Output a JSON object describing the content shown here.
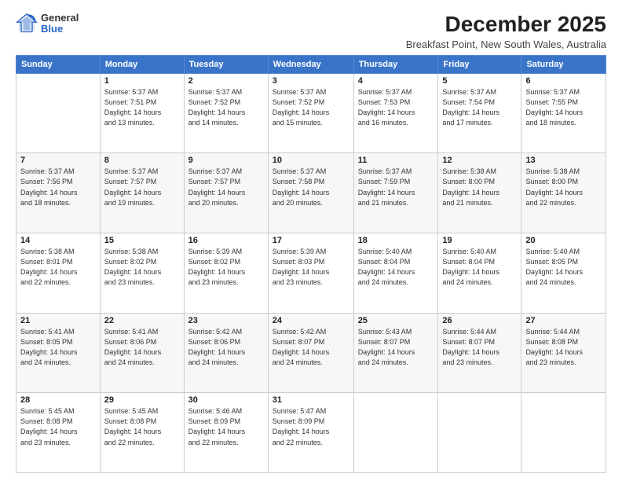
{
  "header": {
    "logo_general": "General",
    "logo_blue": "Blue",
    "title": "December 2025",
    "subtitle": "Breakfast Point, New South Wales, Australia"
  },
  "columns": [
    "Sunday",
    "Monday",
    "Tuesday",
    "Wednesday",
    "Thursday",
    "Friday",
    "Saturday"
  ],
  "rows": [
    [
      {
        "day": "",
        "info": ""
      },
      {
        "day": "1",
        "info": "Sunrise: 5:37 AM\nSunset: 7:51 PM\nDaylight: 14 hours\nand 13 minutes."
      },
      {
        "day": "2",
        "info": "Sunrise: 5:37 AM\nSunset: 7:52 PM\nDaylight: 14 hours\nand 14 minutes."
      },
      {
        "day": "3",
        "info": "Sunrise: 5:37 AM\nSunset: 7:52 PM\nDaylight: 14 hours\nand 15 minutes."
      },
      {
        "day": "4",
        "info": "Sunrise: 5:37 AM\nSunset: 7:53 PM\nDaylight: 14 hours\nand 16 minutes."
      },
      {
        "day": "5",
        "info": "Sunrise: 5:37 AM\nSunset: 7:54 PM\nDaylight: 14 hours\nand 17 minutes."
      },
      {
        "day": "6",
        "info": "Sunrise: 5:37 AM\nSunset: 7:55 PM\nDaylight: 14 hours\nand 18 minutes."
      }
    ],
    [
      {
        "day": "7",
        "info": "Sunrise: 5:37 AM\nSunset: 7:56 PM\nDaylight: 14 hours\nand 18 minutes."
      },
      {
        "day": "8",
        "info": "Sunrise: 5:37 AM\nSunset: 7:57 PM\nDaylight: 14 hours\nand 19 minutes."
      },
      {
        "day": "9",
        "info": "Sunrise: 5:37 AM\nSunset: 7:57 PM\nDaylight: 14 hours\nand 20 minutes."
      },
      {
        "day": "10",
        "info": "Sunrise: 5:37 AM\nSunset: 7:58 PM\nDaylight: 14 hours\nand 20 minutes."
      },
      {
        "day": "11",
        "info": "Sunrise: 5:37 AM\nSunset: 7:59 PM\nDaylight: 14 hours\nand 21 minutes."
      },
      {
        "day": "12",
        "info": "Sunrise: 5:38 AM\nSunset: 8:00 PM\nDaylight: 14 hours\nand 21 minutes."
      },
      {
        "day": "13",
        "info": "Sunrise: 5:38 AM\nSunset: 8:00 PM\nDaylight: 14 hours\nand 22 minutes."
      }
    ],
    [
      {
        "day": "14",
        "info": "Sunrise: 5:38 AM\nSunset: 8:01 PM\nDaylight: 14 hours\nand 22 minutes."
      },
      {
        "day": "15",
        "info": "Sunrise: 5:38 AM\nSunset: 8:02 PM\nDaylight: 14 hours\nand 23 minutes."
      },
      {
        "day": "16",
        "info": "Sunrise: 5:39 AM\nSunset: 8:02 PM\nDaylight: 14 hours\nand 23 minutes."
      },
      {
        "day": "17",
        "info": "Sunrise: 5:39 AM\nSunset: 8:03 PM\nDaylight: 14 hours\nand 23 minutes."
      },
      {
        "day": "18",
        "info": "Sunrise: 5:40 AM\nSunset: 8:04 PM\nDaylight: 14 hours\nand 24 minutes."
      },
      {
        "day": "19",
        "info": "Sunrise: 5:40 AM\nSunset: 8:04 PM\nDaylight: 14 hours\nand 24 minutes."
      },
      {
        "day": "20",
        "info": "Sunrise: 5:40 AM\nSunset: 8:05 PM\nDaylight: 14 hours\nand 24 minutes."
      }
    ],
    [
      {
        "day": "21",
        "info": "Sunrise: 5:41 AM\nSunset: 8:05 PM\nDaylight: 14 hours\nand 24 minutes."
      },
      {
        "day": "22",
        "info": "Sunrise: 5:41 AM\nSunset: 8:06 PM\nDaylight: 14 hours\nand 24 minutes."
      },
      {
        "day": "23",
        "info": "Sunrise: 5:42 AM\nSunset: 8:06 PM\nDaylight: 14 hours\nand 24 minutes."
      },
      {
        "day": "24",
        "info": "Sunrise: 5:42 AM\nSunset: 8:07 PM\nDaylight: 14 hours\nand 24 minutes."
      },
      {
        "day": "25",
        "info": "Sunrise: 5:43 AM\nSunset: 8:07 PM\nDaylight: 14 hours\nand 24 minutes."
      },
      {
        "day": "26",
        "info": "Sunrise: 5:44 AM\nSunset: 8:07 PM\nDaylight: 14 hours\nand 23 minutes."
      },
      {
        "day": "27",
        "info": "Sunrise: 5:44 AM\nSunset: 8:08 PM\nDaylight: 14 hours\nand 23 minutes."
      }
    ],
    [
      {
        "day": "28",
        "info": "Sunrise: 5:45 AM\nSunset: 8:08 PM\nDaylight: 14 hours\nand 23 minutes."
      },
      {
        "day": "29",
        "info": "Sunrise: 5:45 AM\nSunset: 8:08 PM\nDaylight: 14 hours\nand 22 minutes."
      },
      {
        "day": "30",
        "info": "Sunrise: 5:46 AM\nSunset: 8:09 PM\nDaylight: 14 hours\nand 22 minutes."
      },
      {
        "day": "31",
        "info": "Sunrise: 5:47 AM\nSunset: 8:09 PM\nDaylight: 14 hours\nand 22 minutes."
      },
      {
        "day": "",
        "info": ""
      },
      {
        "day": "",
        "info": ""
      },
      {
        "day": "",
        "info": ""
      }
    ]
  ]
}
